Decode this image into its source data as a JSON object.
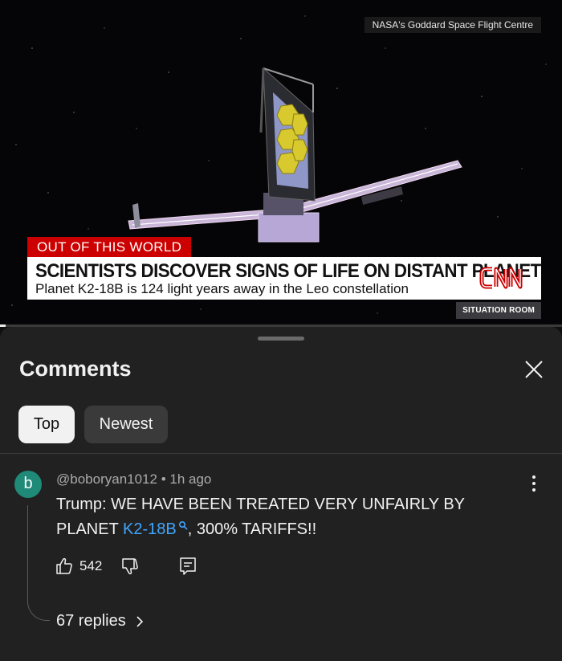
{
  "video": {
    "credit": "NASA's Goddard Space Flight Centre",
    "chyron_kicker": "OUT OF THIS WORLD",
    "chyron_headline": "SCIENTISTS DISCOVER SIGNS OF LIFE ON DISTANT PLANET",
    "chyron_sub": "Planet K2-18B is 124 light years away in the Leo constellation",
    "network_logo": "CNN",
    "show_badge": "SITUATION ROOM",
    "progress": 0.01,
    "colors": {
      "chyron_red": "#cc0000",
      "network_red": "#cc0000"
    }
  },
  "comments_sheet": {
    "title": "Comments",
    "close_icon": "close-icon",
    "sort_chips": [
      {
        "label": "Top",
        "selected": true
      },
      {
        "label": "Newest",
        "selected": false
      }
    ],
    "comment": {
      "avatar_letter": "b",
      "avatar_color": "#1f8a78",
      "author": "@boboryan1012",
      "time": "1h ago",
      "meta_separator": "•",
      "text_before_link": "Trump: WE HAVE BEEN TREATED VERY UNFAIRLY BY PLANET ",
      "link_text": "K2-18B",
      "text_after_link": ", 300% TARIFFS!!",
      "likes": "542",
      "replies_label": "67 replies"
    },
    "colors": {
      "link": "#3ea6ff",
      "background": "#212121"
    }
  }
}
